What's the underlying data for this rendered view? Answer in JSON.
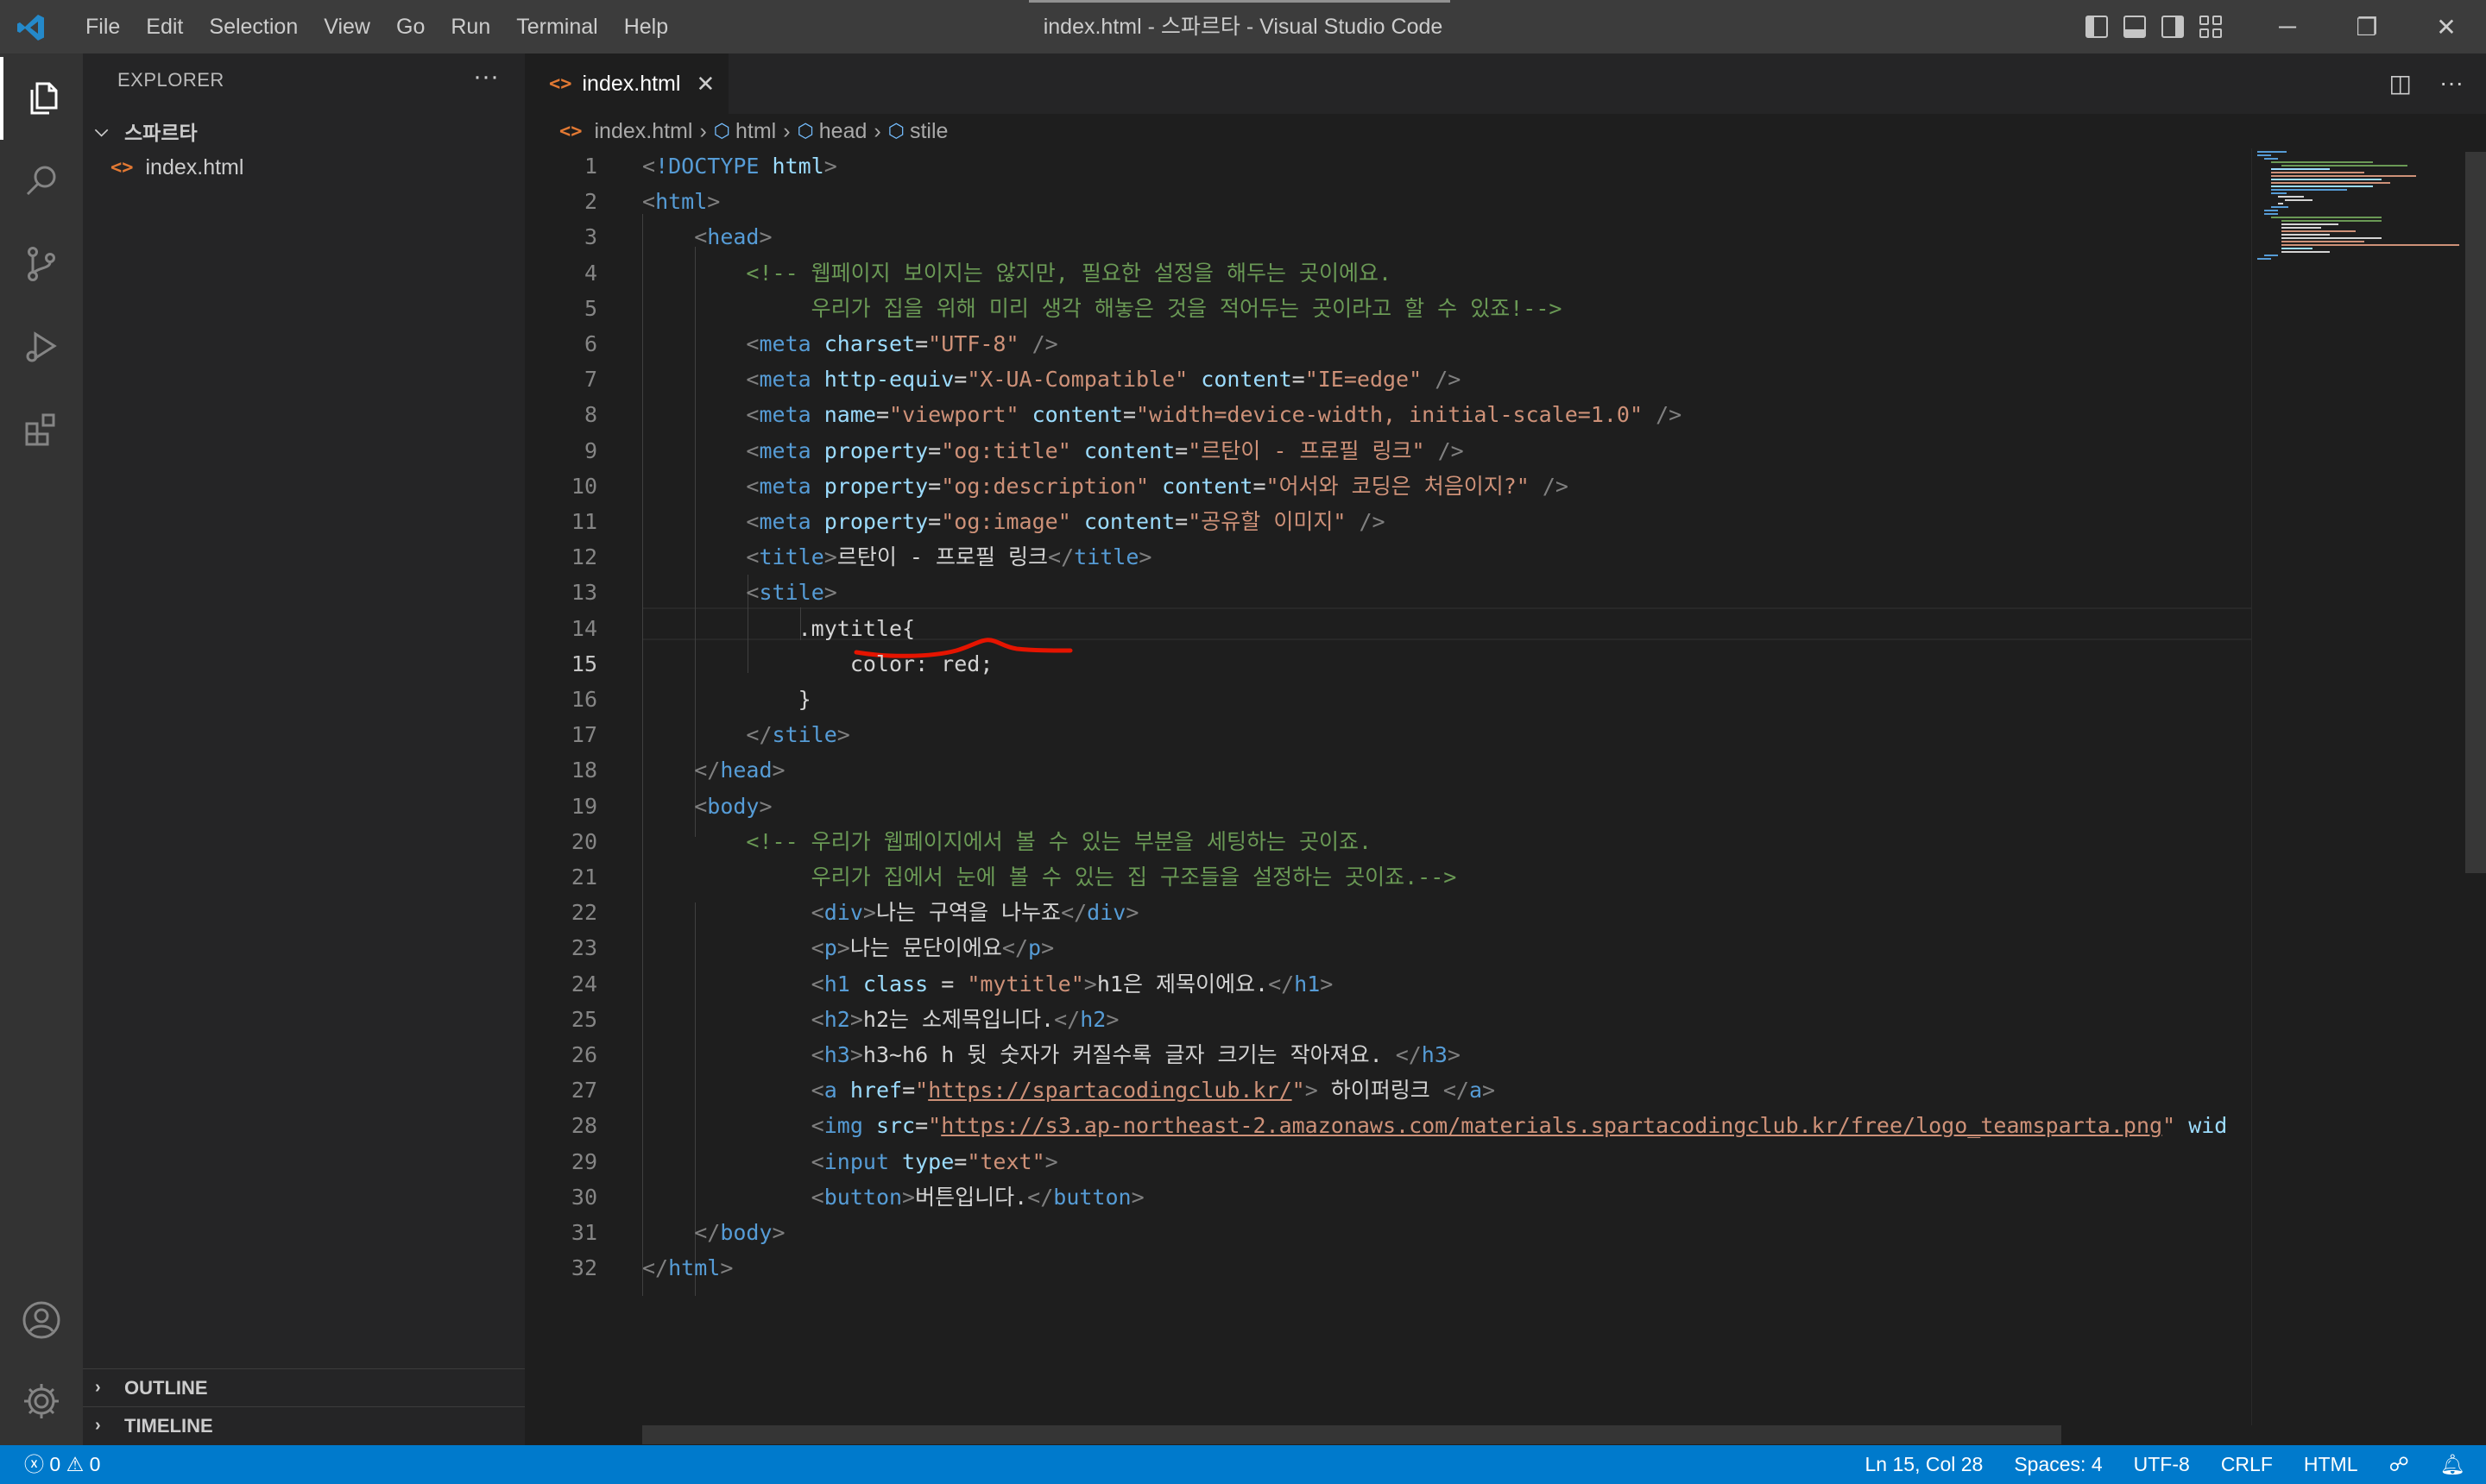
{
  "window": {
    "title": "index.html - 스파르타 - Visual Studio Code",
    "menu": [
      "File",
      "Edit",
      "Selection",
      "View",
      "Go",
      "Run",
      "Terminal",
      "Help"
    ]
  },
  "sidebar": {
    "header": "EXPLORER",
    "folder": "스파르타",
    "file": "index.html",
    "outline": "OUTLINE",
    "timeline": "TIMELINE"
  },
  "editor": {
    "tab": "index.html",
    "breadcrumb": [
      "index.html",
      "html",
      "head",
      "stile"
    ],
    "current_line": 15,
    "lines": [
      [
        [
          "t",
          "<"
        ],
        [
          "tn",
          "!DOCTYPE "
        ],
        [
          "at",
          "html"
        ],
        [
          "t",
          ">"
        ]
      ],
      [
        [
          "t",
          "<"
        ],
        [
          "tn",
          "html"
        ],
        [
          "t",
          ">"
        ]
      ],
      [
        [
          "tx",
          "    "
        ],
        [
          "t",
          "<"
        ],
        [
          "tn",
          "head"
        ],
        [
          "t",
          ">"
        ]
      ],
      [
        [
          "tx",
          "        "
        ],
        [
          "cm",
          "<!-- 웹페이지 보이지는 않지만, 필요한 설정을 해두는 곳이에요."
        ]
      ],
      [
        [
          "tx",
          "             "
        ],
        [
          "cm",
          "우리가 집을 위해 미리 생각 해놓은 것을 적어두는 곳이라고 할 수 있죠!-->"
        ]
      ],
      [
        [
          "tx",
          "        "
        ],
        [
          "t",
          "<"
        ],
        [
          "tn",
          "meta "
        ],
        [
          "at",
          "charset"
        ],
        [
          "tx",
          "="
        ],
        [
          "sv",
          "\"UTF-8\""
        ],
        [
          "t",
          " />"
        ]
      ],
      [
        [
          "tx",
          "        "
        ],
        [
          "t",
          "<"
        ],
        [
          "tn",
          "meta "
        ],
        [
          "at",
          "http-equiv"
        ],
        [
          "tx",
          "="
        ],
        [
          "sv",
          "\"X-UA-Compatible\""
        ],
        [
          "tx",
          " "
        ],
        [
          "at",
          "content"
        ],
        [
          "tx",
          "="
        ],
        [
          "sv",
          "\"IE=edge\""
        ],
        [
          "t",
          " />"
        ]
      ],
      [
        [
          "tx",
          "        "
        ],
        [
          "t",
          "<"
        ],
        [
          "tn",
          "meta "
        ],
        [
          "at",
          "name"
        ],
        [
          "tx",
          "="
        ],
        [
          "sv",
          "\"viewport\""
        ],
        [
          "tx",
          " "
        ],
        [
          "at",
          "content"
        ],
        [
          "tx",
          "="
        ],
        [
          "sv",
          "\"width=device-width, initial-scale=1.0\""
        ],
        [
          "t",
          " />"
        ]
      ],
      [
        [
          "tx",
          "        "
        ],
        [
          "t",
          "<"
        ],
        [
          "tn",
          "meta "
        ],
        [
          "at",
          "property"
        ],
        [
          "tx",
          "="
        ],
        [
          "sv",
          "\"og:title\""
        ],
        [
          "tx",
          " "
        ],
        [
          "at",
          "content"
        ],
        [
          "tx",
          "="
        ],
        [
          "sv",
          "\"르탄이 - 프로필 링크\""
        ],
        [
          "t",
          " />"
        ]
      ],
      [
        [
          "tx",
          "        "
        ],
        [
          "t",
          "<"
        ],
        [
          "tn",
          "meta "
        ],
        [
          "at",
          "property"
        ],
        [
          "tx",
          "="
        ],
        [
          "sv",
          "\"og:description\""
        ],
        [
          "tx",
          " "
        ],
        [
          "at",
          "content"
        ],
        [
          "tx",
          "="
        ],
        [
          "sv",
          "\"어서와 코딩은 처음이지?\""
        ],
        [
          "t",
          " />"
        ]
      ],
      [
        [
          "tx",
          "        "
        ],
        [
          "t",
          "<"
        ],
        [
          "tn",
          "meta "
        ],
        [
          "at",
          "property"
        ],
        [
          "tx",
          "="
        ],
        [
          "sv",
          "\"og:image\""
        ],
        [
          "tx",
          " "
        ],
        [
          "at",
          "content"
        ],
        [
          "tx",
          "="
        ],
        [
          "sv",
          "\"공유할 이미지\""
        ],
        [
          "t",
          " />"
        ]
      ],
      [
        [
          "tx",
          "        "
        ],
        [
          "t",
          "<"
        ],
        [
          "tn",
          "title"
        ],
        [
          "t",
          ">"
        ],
        [
          "tx",
          "르탄이 - 프로필 링크"
        ],
        [
          "t",
          "</"
        ],
        [
          "tn",
          "title"
        ],
        [
          "t",
          ">"
        ]
      ],
      [
        [
          "tx",
          "        "
        ],
        [
          "t",
          "<"
        ],
        [
          "tn",
          "stile"
        ],
        [
          "t",
          ">"
        ]
      ],
      [
        [
          "tx",
          "            .mytitle{"
        ]
      ],
      [
        [
          "tx",
          "                color: red;"
        ]
      ],
      [
        [
          "tx",
          "            }"
        ]
      ],
      [
        [
          "tx",
          "        "
        ],
        [
          "t",
          "</"
        ],
        [
          "tn",
          "stile"
        ],
        [
          "t",
          ">"
        ]
      ],
      [
        [
          "tx",
          "    "
        ],
        [
          "t",
          "</"
        ],
        [
          "tn",
          "head"
        ],
        [
          "t",
          ">"
        ]
      ],
      [
        [
          "tx",
          "    "
        ],
        [
          "t",
          "<"
        ],
        [
          "tn",
          "body"
        ],
        [
          "t",
          ">"
        ]
      ],
      [
        [
          "tx",
          "        "
        ],
        [
          "cm",
          "<!-- 우리가 웹페이지에서 볼 수 있는 부분을 세팅하는 곳이죠."
        ]
      ],
      [
        [
          "tx",
          "             "
        ],
        [
          "cm",
          "우리가 집에서 눈에 볼 수 있는 집 구조들을 설정하는 곳이죠.-->"
        ]
      ],
      [
        [
          "tx",
          "             "
        ],
        [
          "t",
          "<"
        ],
        [
          "tn",
          "div"
        ],
        [
          "t",
          ">"
        ],
        [
          "tx",
          "나는 구역을 나누죠"
        ],
        [
          "t",
          "</"
        ],
        [
          "tn",
          "div"
        ],
        [
          "t",
          ">"
        ]
      ],
      [
        [
          "tx",
          "             "
        ],
        [
          "t",
          "<"
        ],
        [
          "tn",
          "p"
        ],
        [
          "t",
          ">"
        ],
        [
          "tx",
          "나는 문단이에요"
        ],
        [
          "t",
          "</"
        ],
        [
          "tn",
          "p"
        ],
        [
          "t",
          ">"
        ]
      ],
      [
        [
          "tx",
          "             "
        ],
        [
          "t",
          "<"
        ],
        [
          "tn",
          "h1 "
        ],
        [
          "at",
          "class"
        ],
        [
          "tx",
          " = "
        ],
        [
          "sv",
          "\"mytitle\""
        ],
        [
          "t",
          ">"
        ],
        [
          "tx",
          "h1은 제목이에요."
        ],
        [
          "t",
          "</"
        ],
        [
          "tn",
          "h1"
        ],
        [
          "t",
          ">"
        ]
      ],
      [
        [
          "tx",
          "             "
        ],
        [
          "t",
          "<"
        ],
        [
          "tn",
          "h2"
        ],
        [
          "t",
          ">"
        ],
        [
          "tx",
          "h2는 소제목입니다."
        ],
        [
          "t",
          "</"
        ],
        [
          "tn",
          "h2"
        ],
        [
          "t",
          ">"
        ]
      ],
      [
        [
          "tx",
          "             "
        ],
        [
          "t",
          "<"
        ],
        [
          "tn",
          "h3"
        ],
        [
          "t",
          ">"
        ],
        [
          "tx",
          "h3~h6 h 뒷 숫자가 커질수록 글자 크기는 작아져요. "
        ],
        [
          "t",
          "</"
        ],
        [
          "tn",
          "h3"
        ],
        [
          "t",
          ">"
        ]
      ],
      [
        [
          "tx",
          "             "
        ],
        [
          "t",
          "<"
        ],
        [
          "tn",
          "a "
        ],
        [
          "at",
          "href"
        ],
        [
          "tx",
          "="
        ],
        [
          "sv",
          "\""
        ],
        [
          "svu",
          "https://spartacodingclub.kr/"
        ],
        [
          "sv",
          "\""
        ],
        [
          "t",
          ">"
        ],
        [
          "tx",
          " 하이퍼링크 "
        ],
        [
          "t",
          "</"
        ],
        [
          "tn",
          "a"
        ],
        [
          "t",
          ">"
        ]
      ],
      [
        [
          "tx",
          "             "
        ],
        [
          "t",
          "<"
        ],
        [
          "tn",
          "img "
        ],
        [
          "at",
          "src"
        ],
        [
          "tx",
          "="
        ],
        [
          "sv",
          "\""
        ],
        [
          "svu",
          "https://s3.ap-northeast-2.amazonaws.com/materials.spartacodingclub.kr/free/logo_teamsparta.png"
        ],
        [
          "sv",
          "\""
        ],
        [
          "tx",
          " "
        ],
        [
          "at",
          "wid"
        ]
      ],
      [
        [
          "tx",
          "             "
        ],
        [
          "t",
          "<"
        ],
        [
          "tn",
          "input "
        ],
        [
          "at",
          "type"
        ],
        [
          "tx",
          "="
        ],
        [
          "sv",
          "\"text\""
        ],
        [
          "t",
          ">"
        ]
      ],
      [
        [
          "tx",
          "             "
        ],
        [
          "t",
          "<"
        ],
        [
          "tn",
          "button"
        ],
        [
          "t",
          ">"
        ],
        [
          "tx",
          "버튼입니다."
        ],
        [
          "t",
          "</"
        ],
        [
          "tn",
          "button"
        ],
        [
          "t",
          ">"
        ]
      ],
      [
        [
          "tx",
          "    "
        ],
        [
          "t",
          "</"
        ],
        [
          "tn",
          "body"
        ],
        [
          "t",
          ">"
        ]
      ],
      [
        [
          "t",
          "</"
        ],
        [
          "tn",
          "html"
        ],
        [
          "t",
          ">"
        ]
      ]
    ]
  },
  "statusbar": {
    "errors": "0",
    "warnings": "0",
    "position": "Ln 15, Col 28",
    "spaces": "Spaces: 4",
    "encoding": "UTF-8",
    "eol": "CRLF",
    "language": "HTML"
  },
  "colors": {
    "accent": "#007acc",
    "annotation": "#e51400",
    "file_icon": "#e37933"
  }
}
